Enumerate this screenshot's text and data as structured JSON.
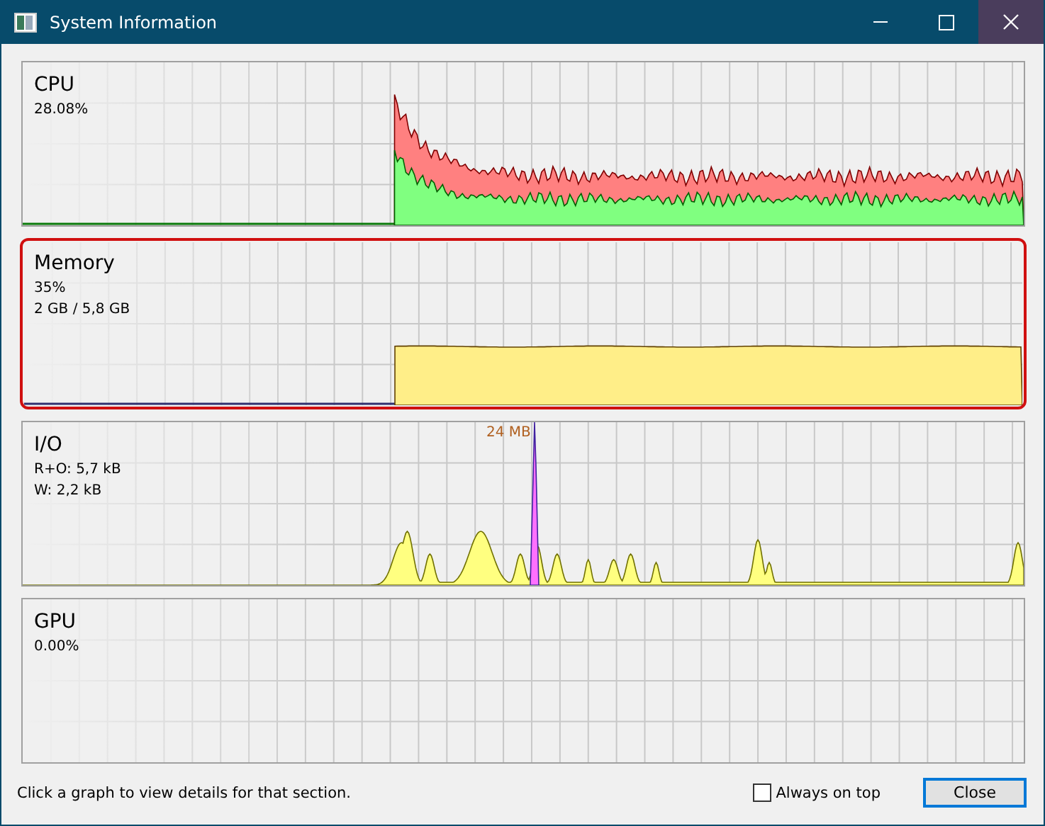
{
  "window": {
    "title": "System Information"
  },
  "panels": [
    {
      "kind": "cpu",
      "title": "CPU",
      "selected": false,
      "lines": [
        "28.08%"
      ]
    },
    {
      "kind": "memory",
      "title": "Memory",
      "selected": true,
      "lines": [
        "35%",
        "2 GB / 5,8 GB"
      ]
    },
    {
      "kind": "io",
      "title": "I/O",
      "selected": false,
      "lines": [
        "R+O: 5,7 kB",
        "W: 2,2 kB"
      ],
      "peak_label": "24 MB"
    },
    {
      "kind": "gpu",
      "title": "GPU",
      "selected": false,
      "lines": [
        "0.00%"
      ]
    }
  ],
  "footer": {
    "hint": "Click a graph to view details for that section.",
    "always_on_top": {
      "label": "Always on top",
      "checked": false
    },
    "close_button": "Close"
  }
}
